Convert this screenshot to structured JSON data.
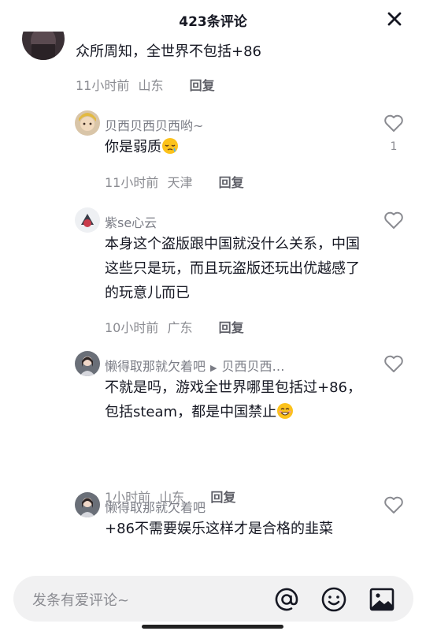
{
  "header": {
    "title": "423条评论"
  },
  "comments": [
    {
      "text": "众所周知，全世界不包括+86",
      "time": "11小时前",
      "location": "山东",
      "reply_label": "回复"
    },
    {
      "username": "贝西贝西贝西哟~",
      "text": "你是弱质",
      "emoji": "sleepy-face-emoji",
      "time": "11小时前",
      "location": "天津",
      "reply_label": "回复",
      "likes": "1"
    },
    {
      "username": "紫se心云",
      "text": "本身这个盗版跟中国就没什么关系，中国这些只是玩，而且玩盗版还玩出优越感了的玩意儿而已",
      "time": "10小时前",
      "location": "广东",
      "reply_label": "回复"
    },
    {
      "username": "懒得取那就欠着吧",
      "reply_to": "贝西贝西…",
      "text": "不就是吗，游戏全世界哪里包括过+86，包括steam，都是中国禁止",
      "emoji": "grinning-face-emoji",
      "time": "1小时前",
      "location": "山东",
      "reply_label": "回复"
    },
    {
      "username": "懒得取那就欠着吧",
      "text": "+86不需要娱乐这样才是合格的韭菜"
    }
  ],
  "input_bar": {
    "placeholder": "发条有爱评论~",
    "icons": [
      "at-icon",
      "emoji-icon",
      "image-icon"
    ]
  }
}
